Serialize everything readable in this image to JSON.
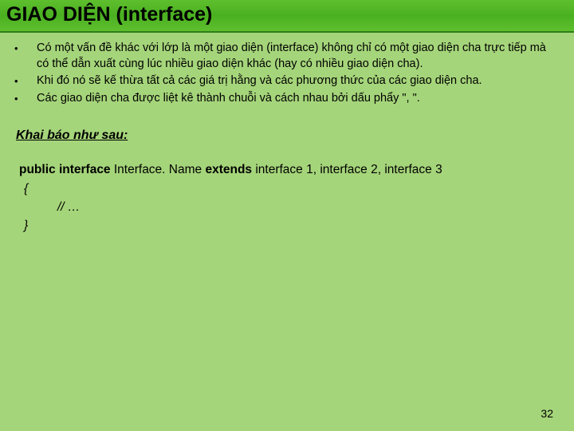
{
  "title": "GIAO DIỆN (interface)",
  "bullets": [
    "Có một vấn đề khác với lớp là một giao diện (interface) không chỉ có một giao diện cha trực tiếp mà có thể dẫn xuất cùng lúc nhiều giao diện khác (hay có nhiều giao diện cha).",
    "Khi đó nó sẽ kế thừa tất cả các giá trị hằng và các phương thức của các giao diện cha.",
    "Các giao diện cha được liệt kê thành chuỗi và cách nhau bởi dấu phẩy \", \"."
  ],
  "declare_label": "Khai báo như sau:",
  "code": {
    "kw_public": "public interface",
    "name": " Interface. Name ",
    "kw_extends": "extends",
    "params": " interface 1, interface 2, interface 3",
    "brace_open": "{",
    "comment": "// …",
    "brace_close": "}"
  },
  "page_num": "32"
}
